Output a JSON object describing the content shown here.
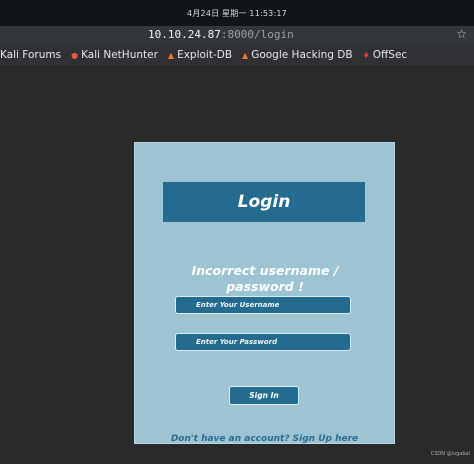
{
  "system": {
    "clock": "4月24日 星期一  11:53:17"
  },
  "browser": {
    "url_host": "10.10.24.87",
    "url_path": ":8000/login",
    "bookmarks": [
      {
        "label": "Kali Forums",
        "icon": "kali-icon"
      },
      {
        "label": "Kali NetHunter",
        "icon": "nethunter-icon"
      },
      {
        "label": "Exploit-DB",
        "icon": "exploitdb-icon"
      },
      {
        "label": "Google Hacking DB",
        "icon": "ghdb-icon"
      },
      {
        "label": "OffSec",
        "icon": "offsec-icon"
      }
    ]
  },
  "login": {
    "title": "Login",
    "error": "Incorrect username / password !",
    "username_placeholder": "Enter Your Username",
    "password_placeholder": "Enter Your Password",
    "signin_label": "Sign In",
    "signup_text": "Don't have an account? Sign Up here"
  },
  "watermark": "CSDN @lugabal",
  "colors": {
    "panel": "#9ec3d2",
    "accent": "#236c90",
    "page_bg": "#2a2a2a"
  }
}
